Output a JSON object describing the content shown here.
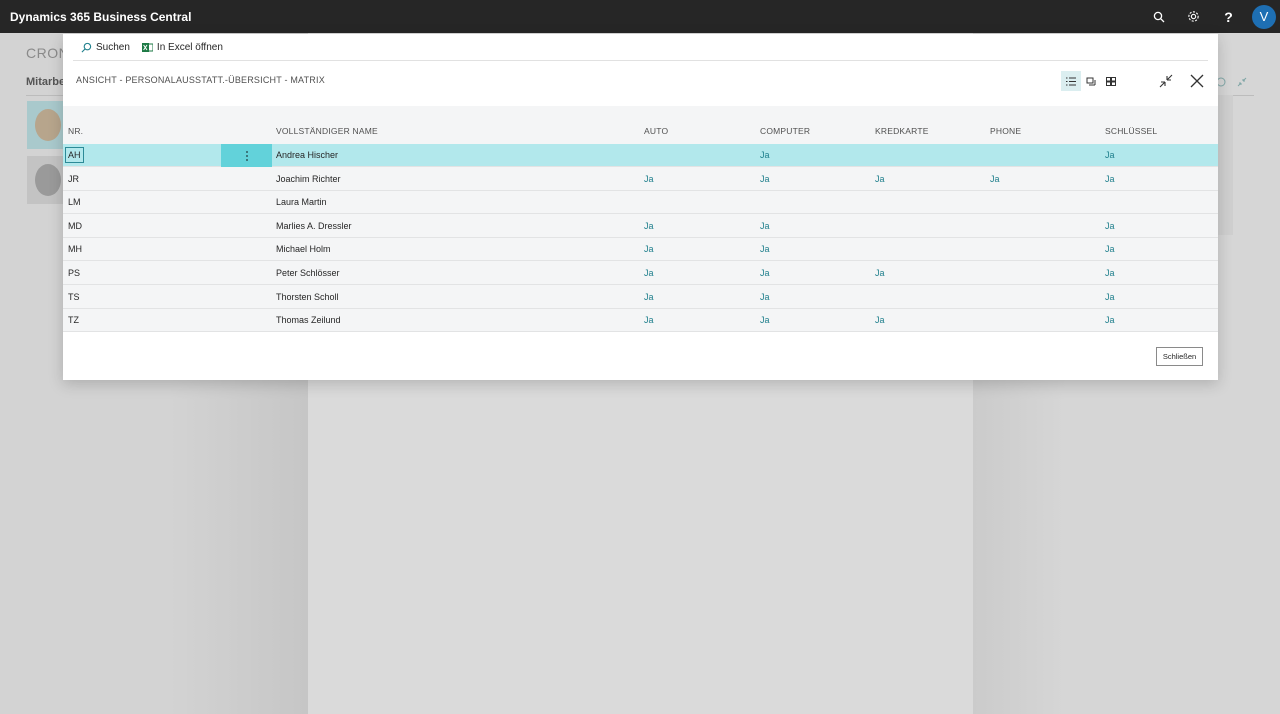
{
  "app": {
    "title": "Dynamics 365 Business Central",
    "user_initial": "V",
    "icons": [
      "search-icon",
      "gear-icon",
      "help-icon"
    ]
  },
  "background": {
    "page_title": "CRON",
    "section_label": "Mitarbe"
  },
  "dialog": {
    "actions": [
      {
        "label": "Suchen",
        "icon": "search-icon"
      },
      {
        "label": "In Excel öffnen",
        "icon": "excel-icon"
      }
    ],
    "title": "ANSICHT - PERSONALAUSSTATT.-ÜBERSICHT - MATRIX",
    "view_modes": [
      "list-view-icon",
      "tile-view-icon",
      "grid-view-icon"
    ],
    "close_button_label": "Schließen"
  },
  "grid": {
    "columns": [
      "NR.",
      "VOLLSTÄNDIGER NAME",
      "AUTO",
      "COMPUTER",
      "KREDKARTE",
      "PHONE",
      "SCHLÜSSEL"
    ],
    "rows": [
      {
        "nr": "AH",
        "name": "Andrea Hischer",
        "auto": "",
        "computer": "Ja",
        "kredkarte": "",
        "phone": "",
        "schluessel": "Ja"
      },
      {
        "nr": "JR",
        "name": "Joachim Richter",
        "auto": "Ja",
        "computer": "Ja",
        "kredkarte": "Ja",
        "phone": "Ja",
        "schluessel": "Ja"
      },
      {
        "nr": "LM",
        "name": "Laura Martin",
        "auto": "",
        "computer": "",
        "kredkarte": "",
        "phone": "",
        "schluessel": ""
      },
      {
        "nr": "MD",
        "name": "Marlies A. Dressler",
        "auto": "Ja",
        "computer": "Ja",
        "kredkarte": "",
        "phone": "",
        "schluessel": "Ja"
      },
      {
        "nr": "MH",
        "name": "Michael Holm",
        "auto": "Ja",
        "computer": "Ja",
        "kredkarte": "",
        "phone": "",
        "schluessel": "Ja"
      },
      {
        "nr": "PS",
        "name": "Peter Schlösser",
        "auto": "Ja",
        "computer": "Ja",
        "kredkarte": "Ja",
        "phone": "",
        "schluessel": "Ja"
      },
      {
        "nr": "TS",
        "name": "Thorsten Scholl",
        "auto": "Ja",
        "computer": "Ja",
        "kredkarte": "",
        "phone": "",
        "schluessel": "Ja"
      },
      {
        "nr": "TZ",
        "name": "Thomas Zeilund",
        "auto": "Ja",
        "computer": "Ja",
        "kredkarte": "Ja",
        "phone": "",
        "schluessel": "Ja"
      }
    ]
  },
  "colors": {
    "topbar": "#262626",
    "accent": "#1f7f8c",
    "selected_row": "#b2e8ec",
    "row_menu": "#62d2da"
  }
}
